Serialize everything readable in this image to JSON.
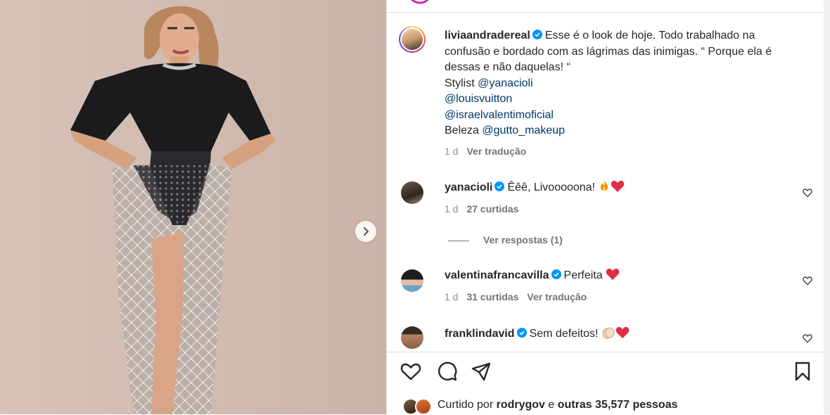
{
  "post": {
    "author": "liviaandradereal",
    "caption_lines": [
      "Esse é o look de hoje. Todo trabalhado na",
      "confusão e bordado com as lágrimas das inimigas. “ Porque ela é",
      "dessas e não daquelas! “"
    ],
    "stylist_prefix": "Stylist ",
    "stylist_mention": "@yanacioli",
    "mention_2": "@louisvuitton",
    "mention_3": "@israelvalentimoficial",
    "beleza_prefix": "Beleza ",
    "beleza_mention": "@gutto_makeup",
    "time": "1 d",
    "translate": "Ver tradução"
  },
  "comments": [
    {
      "username": "yanacioli",
      "text": "Êêê, Livooooona!",
      "emoji": [
        "fire",
        "red-heart"
      ],
      "time": "1 d",
      "likes": "27 curtidas"
    },
    {
      "username": "valentinafrancavilla",
      "text": "Perfeita",
      "emoji": [
        "red-heart"
      ],
      "time": "1 d",
      "likes": "31 curtidas",
      "translate": "Ver tradução"
    },
    {
      "username": "franklindavid",
      "text": "Sem defeitos!",
      "emoji": [
        "clapping-hands",
        "red-heart"
      ]
    }
  ],
  "replies_link": "Ver respostas (1)",
  "likes": {
    "prefix": "Curtido por ",
    "user": "rodrygov",
    "middle": " e ",
    "others": "outras 35,577 pessoas"
  },
  "icons": {
    "like": "heart-outline-icon",
    "comment": "comment-bubble-icon",
    "share": "paper-plane-icon",
    "save": "bookmark-icon",
    "next": "chevron-right-icon",
    "verified": "verified-badge-icon"
  },
  "colors": {
    "mention": "#00376b",
    "verified": "#0095f6",
    "muted": "#8e8e8e",
    "text": "#262626",
    "divider": "#dbdbdb"
  }
}
